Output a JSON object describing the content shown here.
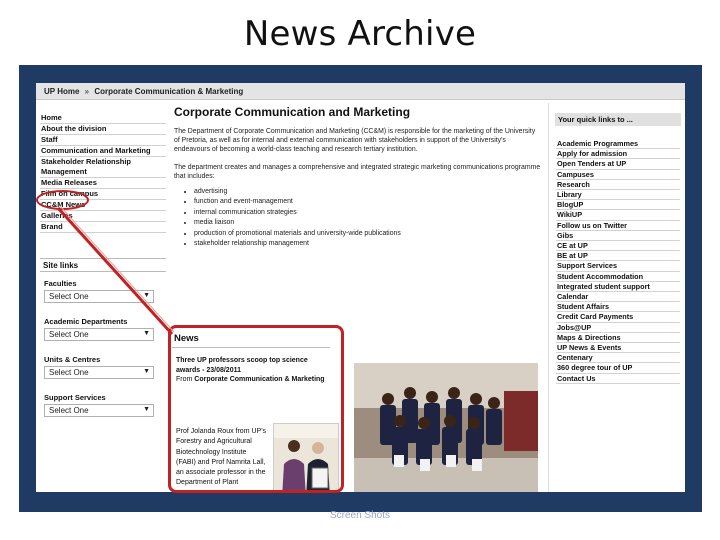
{
  "slide": {
    "title": "News Archive",
    "footer": "Screen Shots"
  },
  "breadcrumb": {
    "home": "UP Home",
    "separator": "»",
    "current": "Corporate Communication & Marketing"
  },
  "left_nav": {
    "items": [
      "Home",
      "About the division",
      "Staff",
      "Communication and Marketing",
      "Stakeholder Relationship Management",
      "Media Releases",
      "Film on campus",
      "CC&M News",
      "Galleries",
      "Brand"
    ]
  },
  "site_links": {
    "header": "Site links",
    "groups": [
      {
        "label": "Faculties",
        "value": "Select One"
      },
      {
        "label": "Academic Departments",
        "value": "Select One"
      },
      {
        "label": "Units & Centres",
        "value": "Select One"
      },
      {
        "label": "Support Services",
        "value": "Select One"
      }
    ]
  },
  "main": {
    "heading": "Corporate Communication and Marketing",
    "intro_1": "The Department of Corporate Communication and Marketing (CC&M) is responsible for the marketing of the University of Pretoria, as well as for internal and external communication with stakeholders in support of the University's endeavours of becoming a world-class teaching and research tertiary institution.",
    "intro_2": "The department creates and manages a comprehensive and integrated strategic marketing communications programme that includes:",
    "bullets": [
      "advertising",
      "function and event-management",
      "internal communication strategies",
      "media liaison",
      "production of promotional materials and university-wide publications",
      "stakeholder relationship management"
    ]
  },
  "news": {
    "title": "News",
    "headline": "Three UP professors scoop top science awards - 23/08/2011",
    "from_prefix": "From",
    "from_source": "Corporate Communication & Marketing",
    "body": "Prof Jolanda Roux from UP's Forestry and Agricultural Biotechnology Institute (FABI) and Prof Namrita Lall, an associate professor in the Department of Plant"
  },
  "quick_links": {
    "header": "Your quick links to ...",
    "items": [
      "Academic Programmes",
      "Apply for admission",
      "Open Tenders at UP",
      "Campuses",
      "Research",
      "Library",
      "BlogUP",
      "WikiUP",
      "Follow us on Twitter",
      "Gibs",
      "CE at UP",
      "BE at UP",
      "Support Services",
      "Student Accommodation",
      "Integrated student support",
      "Calendar",
      "Student Affairs",
      "Credit Card Payments",
      "Jobs@UP",
      "Maps & Directions",
      "UP News & Events",
      "Centenary",
      "360 degree tour of UP",
      "Contact Us"
    ]
  },
  "colors": {
    "frame": "#1f3b63",
    "highlight": "#c22222"
  },
  "icons": {
    "select_arrow": "chevron-down-icon"
  }
}
